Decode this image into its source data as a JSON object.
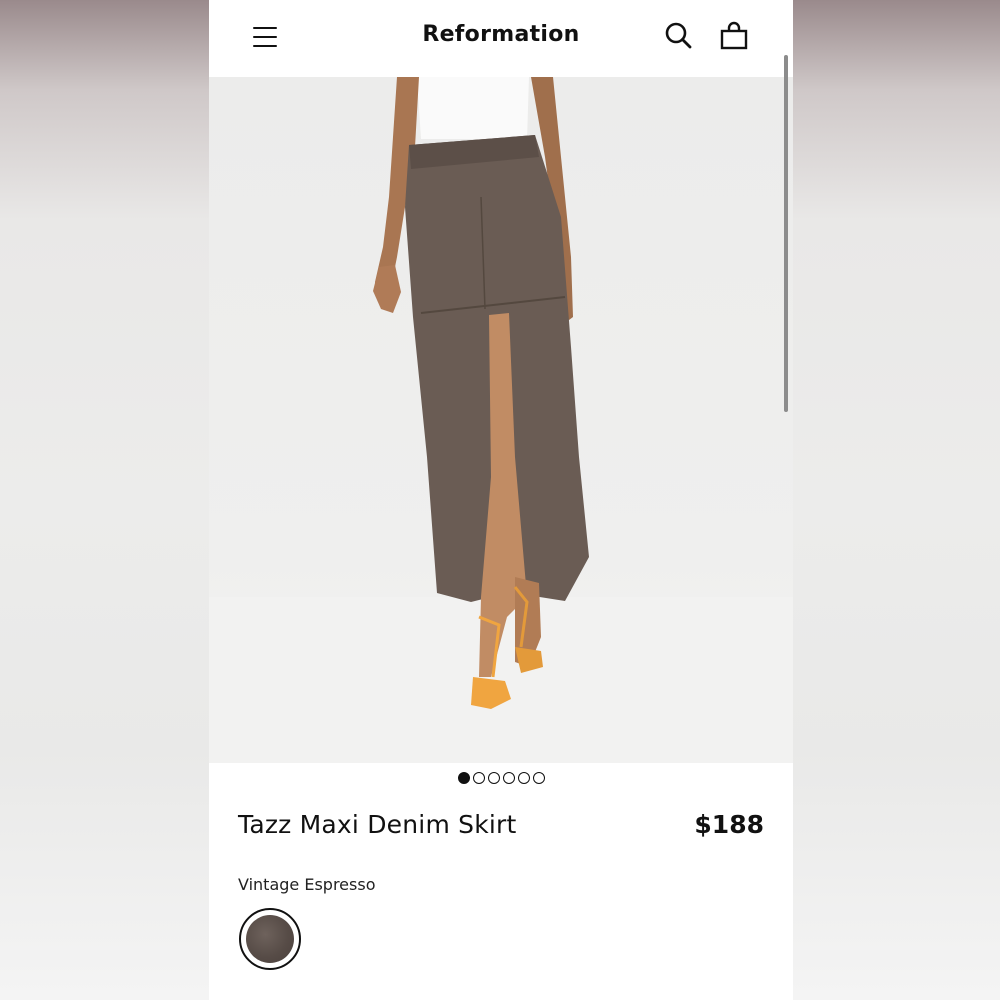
{
  "header": {
    "brand": "Reformation",
    "menu_icon": "hamburger-menu-icon",
    "search_icon": "search-icon",
    "bag_icon": "shopping-bag-icon"
  },
  "gallery": {
    "image_count": 6,
    "active_index": 0
  },
  "product": {
    "name": "Tazz Maxi Denim Skirt",
    "price": "$188",
    "color_name": "Vintage Espresso",
    "swatch_color": "#5a4e49"
  }
}
